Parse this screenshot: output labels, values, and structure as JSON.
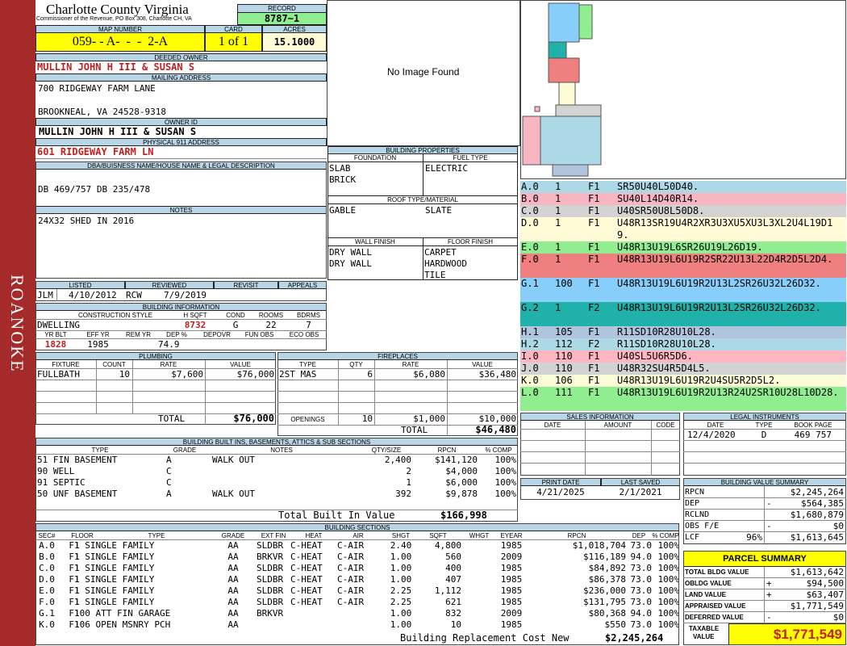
{
  "sidebar_text": "ROANOKE",
  "county": "Charlotte County Virginia",
  "county_sub": "Commissioner of the Revenue, PO Box 308, Charlotte CH, VA",
  "record_label": "RECORD",
  "record": "8787~1",
  "map_label": "MAP NUMBER",
  "map": "059- - A-  -  -  2-A",
  "card_label": "CARD",
  "card": "1 of 1",
  "acres_label": "ACRES",
  "acres": "15.1000",
  "owner_label": "DEEDED OWNER",
  "owner": "MULLIN JOHN H III & SUSAN S",
  "mail_label": "MAILING ADDRESS",
  "mail1": "700 RIDGEWAY FARM LANE",
  "mail2": "BROOKNEAL, VA 24528-9318",
  "ownerid_label": "OWNER ID",
  "ownerid": "MULLIN JOHN H III & SUSAN S",
  "phys_label": "PHYSICAL 911 ADDRESS",
  "phys": "601 RIDGEWAY FARM LN",
  "dba_label": "DBA/BUISNESS NAME/HOUSE NAME & LEGAL DESCRIPTION",
  "dba": "DB 469/757 DB  235/478",
  "notes_label": "NOTES",
  "notes": "24X32 SHED IN 2016",
  "no_image": "No Image Found",
  "bp": {
    "title": "BUILDING PROPERTIES",
    "found_label": "FOUNDATION",
    "fuel_label": "FUEL TYPE",
    "found1": "SLAB",
    "found2": "BRICK",
    "fuel": "ELECTRIC",
    "roof_label": "ROOF TYPE/MATERIAL",
    "roof1": "GABLE",
    "roof2": "SLATE",
    "wall_label": "WALL FINISH",
    "floor_label": "FLOOR FINISH",
    "wall1": "DRY WALL",
    "wall2": "DRY WALL",
    "floor1": "CARPET",
    "floor2": "HARDWOOD",
    "floor3": "TILE"
  },
  "listed": {
    "l_label": "LISTED",
    "r_label": "REVIEWED",
    "rv_label": "REVISIT",
    "ap_label": "APPEALS",
    "l_by": "JLM",
    "l_date": "4/10/2012",
    "r_by": "RCW",
    "r_date": "7/9/2019"
  },
  "bi": {
    "title": "BUILDING INFORMATION",
    "cs_label": "CONSTRUCTION STYLE",
    "hs_label": "H SQFT",
    "cond_label": "COND",
    "rooms_label": "ROOMS",
    "bdrms_label": "BDRMS",
    "cs": "DWELLING",
    "hs": "8732",
    "cond": "G",
    "rooms": "22",
    "bdrms": "7",
    "yb_label": "YR BLT",
    "ey_label": "EFF YR",
    "rm_label": "REM YR",
    "dep_label": "DEP %",
    "depovr_label": "DEPOVR",
    "fun_label": "FUN OBS",
    "eco_label": "ECO OBS",
    "yb": "1828",
    "ey": "1985",
    "dep": "74.9"
  },
  "plumb": {
    "title": "PLUMBING",
    "h": [
      "FIXTURE",
      "COUNT",
      "RATE",
      "VALUE"
    ],
    "row": [
      "FULLBATH",
      "10",
      "$7,600",
      "$76,000"
    ],
    "total_label": "TOTAL",
    "total": "$76,000"
  },
  "fire": {
    "title": "FIREPLACES",
    "h": [
      "TYPE",
      "QTY",
      "RATE",
      "VALUE"
    ],
    "row": [
      "2ST MAS",
      "6",
      "$6,080",
      "$36,480"
    ],
    "open_label": "OPENINGS",
    "open": [
      "10",
      "$1,000",
      "$10,000"
    ],
    "total_label": "TOTAL",
    "total": "$46,480"
  },
  "bbi": {
    "title": "BUILDING BUILT INS, BASEMENTS, ATTICS & SUB SECTIONS",
    "h": [
      "TYPE",
      "GRADE",
      "NOTES",
      "QTY/SIZE",
      "RPCN",
      "% COMP"
    ],
    "rows": [
      [
        "51 FIN BASEMENT",
        "A",
        "WALK OUT",
        "2,400",
        "$141,120",
        "100%"
      ],
      [
        "90 WELL",
        "C",
        "",
        "2",
        "$4,000",
        "100%"
      ],
      [
        "91 SEPTIC",
        "C",
        "",
        "1",
        "$6,000",
        "100%"
      ],
      [
        "50 UNF BASEMENT",
        "A",
        "WALK OUT",
        "392",
        "$9,878",
        "100%"
      ]
    ],
    "total_label": "Total Built In Value",
    "total": "$166,998"
  },
  "bs": {
    "title": "BUILDING SECTIONS",
    "h": [
      "SEC#",
      "FLOOR",
      "TYPE",
      "GRADE",
      "EXT FIN",
      "HEAT",
      "AIR",
      "SHGT",
      "SQFT",
      "WHGT",
      "EYEAR",
      "RPCN",
      "DEP",
      "% COMP"
    ],
    "rows": [
      [
        "A.0",
        "F1",
        "1 SINGLE FAMILY",
        "AA",
        "SLDBR",
        "C-HEAT",
        "C-AIR",
        "2.40",
        "4,800",
        "",
        "1985",
        "$1,018,704",
        "73.0",
        "100%"
      ],
      [
        "B.0",
        "F1",
        "1 SINGLE FAMILY",
        "AA",
        "BRKVR",
        "C-HEAT",
        "C-AIR",
        "1.00",
        "560",
        "",
        "2009",
        "$116,189",
        "94.0",
        "100%"
      ],
      [
        "C.0",
        "F1",
        "1 SINGLE FAMILY",
        "AA",
        "SLDBR",
        "C-HEAT",
        "C-AIR",
        "1.00",
        "400",
        "",
        "1985",
        "$84,892",
        "73.0",
        "100%"
      ],
      [
        "D.0",
        "F1",
        "1 SINGLE FAMILY",
        "AA",
        "SLDBR",
        "C-HEAT",
        "C-AIR",
        "1.00",
        "407",
        "",
        "1985",
        "$86,378",
        "73.0",
        "100%"
      ],
      [
        "E.0",
        "F1",
        "1 SINGLE FAMILY",
        "AA",
        "SLDBR",
        "C-HEAT",
        "C-AIR",
        "2.25",
        "1,112",
        "",
        "1985",
        "$236,000",
        "73.0",
        "100%"
      ],
      [
        "F.0",
        "F1",
        "1 SINGLE FAMILY",
        "AA",
        "SLDBR",
        "C-HEAT",
        "C-AIR",
        "2.25",
        "621",
        "",
        "1985",
        "$131,795",
        "73.0",
        "100%"
      ],
      [
        "G.1",
        "F1",
        "100 ATT FIN GARAGE",
        "AA",
        "BRKVR",
        "",
        "",
        "1.00",
        "832",
        "",
        "2009",
        "$80,368",
        "94.0",
        "100%"
      ],
      [
        "K.0",
        "F1",
        "106 OPEN MSNRY PCH",
        "AA",
        "",
        "",
        "",
        "1.00",
        "10",
        "",
        "1985",
        "$550",
        "73.0",
        "100%"
      ]
    ],
    "total_label": "Building Replacement Cost New",
    "total": "$2,245,264"
  },
  "sketch": [
    [
      "A.0",
      "1",
      "F1",
      "SR50U40L50D40.",
      "#add8e6"
    ],
    [
      "B.0",
      "1",
      "F1",
      "SU40L14D40R14.",
      "#f7b6c2"
    ],
    [
      "C.0",
      "1",
      "F1",
      "U40SR50U8L50D8.",
      "#d3d3d3"
    ],
    [
      "D.0",
      "1",
      "F1",
      "U48R13SR19U4R2XR3U3XU5XU3L3XL2U4L19D19.",
      "#fffbd6"
    ],
    [
      "E.0",
      "1",
      "F1",
      "U48R13U19L6SR26U19L26D19.",
      "#90ee90"
    ],
    [
      "F.0",
      "1",
      "F1",
      "U48R13U19L6U19R2SR22U13L22D4R2D5L2D4.",
      "#f08080"
    ],
    [
      "G.1",
      "100",
      "F1",
      "U48R13U19L6U19R2U13L2SR26U32L26D32.",
      "#87cefa"
    ],
    [
      "G.2",
      "1",
      "F2",
      "U48R13U19L6U19R2U13L2SR26U32L26D32.",
      "#20b2aa"
    ],
    [
      "H.1",
      "105",
      "F1",
      "R11SD10R28U10L28.",
      "#b0c4de"
    ],
    [
      "H.2",
      "112",
      "F2",
      "R11SD10R28U10L28.",
      "#add8e6"
    ],
    [
      "I.0",
      "110",
      "F1",
      "U40SL5U6R5D6.",
      "#ffb6c1"
    ],
    [
      "J.0",
      "110",
      "F1",
      "U48R32SU4R5D4L5.",
      "#d3d3d3"
    ],
    [
      "K.0",
      "106",
      "F1",
      "U48R13U19L6U19R2U4SU5R2D5L2.",
      "#fffbd6"
    ],
    [
      "L.0",
      "111",
      "F1",
      "U48R13U19L6U19R2U13R24U2SR10U28L10D28.",
      "#90ee90"
    ]
  ],
  "sales": {
    "title": "SALES INFORMATION",
    "h": [
      "DATE",
      "AMOUNT",
      "CODE"
    ]
  },
  "legal": {
    "title": "LEGAL INSTRUMENTS",
    "h": [
      "DATE",
      "TYPE",
      "BOOK PAGE"
    ],
    "row": [
      "12/4/2020",
      "D",
      "469 757"
    ]
  },
  "print": {
    "pd_label": "PRINT DATE",
    "ls_label": "LAST SAVED",
    "pd": "4/21/2025",
    "ls": "2/1/2021"
  },
  "bvs": {
    "title": "BUILDING VALUE SUMMARY",
    "rpcn_label": "RPCN",
    "rpcn": "$2,245,264",
    "dep_label": "DEP",
    "dep_sign": "-",
    "dep": "$564,385",
    "rclnd_label": "RCLND",
    "rclnd": "$1,680,879",
    "obs_label": "OBS F/E",
    "obs_sign": "-",
    "obs": "$0",
    "lcf_label": "LCF",
    "lcf_pct": "96%",
    "lcf": "$1,613,645"
  },
  "ps": {
    "title": "PARCEL SUMMARY",
    "tb_label": "TOTAL BLDG VALUE",
    "tb": "$1,613,642",
    "ob_label": "OBLDG VALUE",
    "ob_sign": "+",
    "ob": "$94,500",
    "lv_label": "LAND VALUE",
    "lv_sign": "+",
    "lv": "$63,407",
    "av_label": "APPRAISED VALUE",
    "av": "$1,771,549",
    "dv_label": "DEFERRED VALUE",
    "dv_sign": "-",
    "dv": "$0",
    "tv_label1": "TAXABLE",
    "tv_label2": "VALUE",
    "tv": "$1,771,549"
  },
  "colors": {
    "header": "#b9d6e6",
    "sidebar": "#a52a2a",
    "yellow": "#ffff00",
    "red": "#c41e1e"
  }
}
